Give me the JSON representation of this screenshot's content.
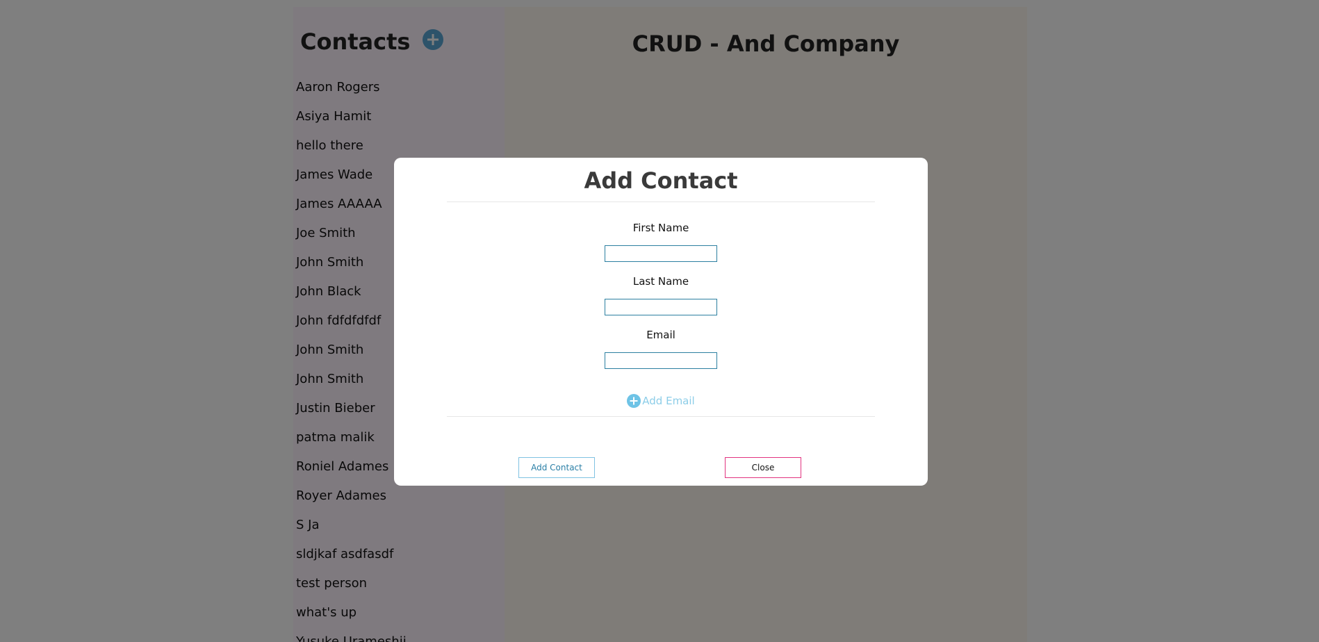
{
  "sidebar": {
    "title": "Contacts",
    "add_icon": "plus-circle-icon",
    "contacts": [
      "Aaron Rogers",
      "Asiya Hamit",
      "hello there",
      "James Wade",
      "James AAAAA",
      "Joe Smith",
      "John Smith",
      "John Black",
      "John fdfdfdfdf",
      "John Smith",
      "John Smith",
      "Justin Bieber",
      "patma malik",
      "Roniel Adames",
      "Royer Adames",
      "S Ja",
      "sldjkaf asdfasdf",
      "test person",
      "what's up",
      "Yusuke Urameshii"
    ]
  },
  "main": {
    "title": "CRUD - And Company"
  },
  "modal": {
    "title": "Add Contact",
    "fields": {
      "first_name": {
        "label": "First Name",
        "value": ""
      },
      "last_name": {
        "label": "Last Name",
        "value": ""
      },
      "email": {
        "label": "Email",
        "value": ""
      }
    },
    "add_email_label": "Add Email",
    "add_email_icon": "plus-circle-icon",
    "add_button_label": "Add Contact",
    "close_button_label": "Close"
  },
  "colors": {
    "sidebar_bg": "#fef4ff",
    "main_bg": "#fff8f1",
    "accent_blue": "#5aa7d4",
    "input_border": "#2b7fa0",
    "close_border": "#e2327f"
  }
}
